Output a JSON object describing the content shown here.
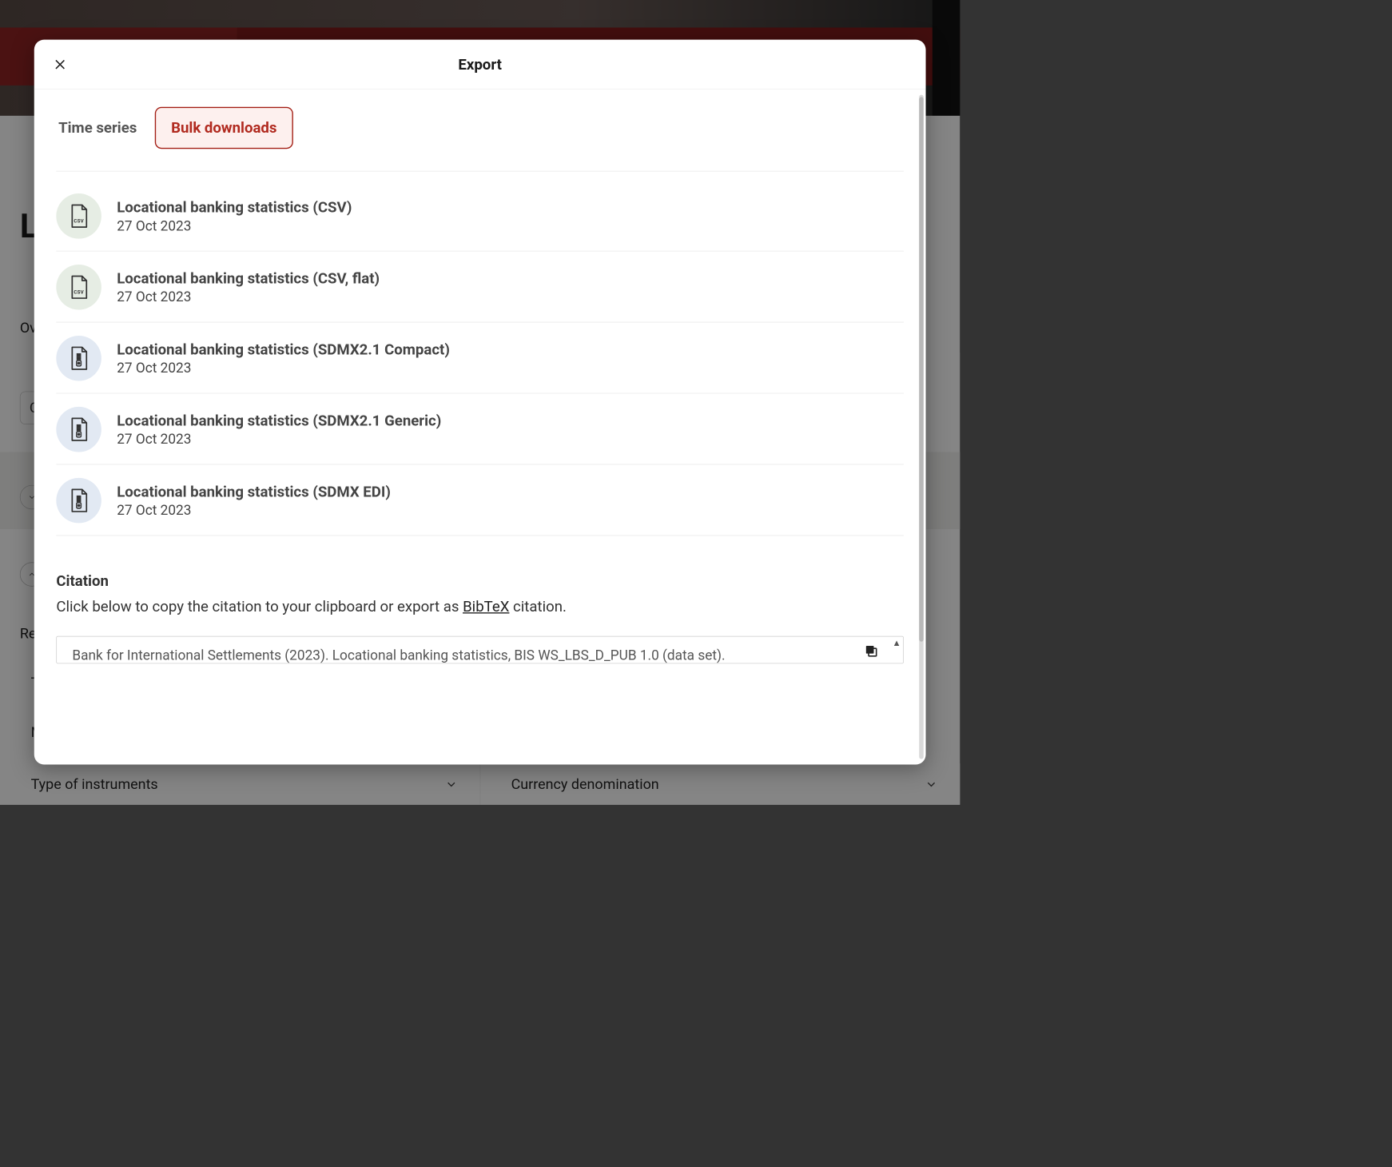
{
  "modal": {
    "title": "Export",
    "tabs": {
      "time_series": "Time series",
      "bulk_downloads": "Bulk downloads"
    },
    "downloads": [
      {
        "title": "Locational banking statistics (CSV)",
        "date": "27 Oct 2023",
        "icon": "csv"
      },
      {
        "title": "Locational banking statistics (CSV, flat)",
        "date": "27 Oct 2023",
        "icon": "csv"
      },
      {
        "title": "Locational banking statistics (SDMX2.1 Compact)",
        "date": "27 Oct 2023",
        "icon": "zip"
      },
      {
        "title": "Locational banking statistics (SDMX2.1 Generic)",
        "date": "27 Oct 2023",
        "icon": "zip"
      },
      {
        "title": "Locational banking statistics (SDMX EDI)",
        "date": "27 Oct 2023",
        "icon": "zip"
      }
    ],
    "citation": {
      "heading": "Citation",
      "instruction_pre": "Click below to copy the citation to your clipboard or export as ",
      "bibtex_label": "BibTeX",
      "instruction_post": " citation.",
      "text": "Bank for International Settlements (2023). Locational banking statistics, BIS WS_LBS_D_PUB 1.0 (data set)."
    }
  },
  "background": {
    "heading_fragment": "L",
    "ov": "Ov",
    "chip": "C",
    "re": "Re",
    "table_marker": "T",
    "m_marker": "M",
    "filters": {
      "type_of_instruments": "Type of instruments",
      "currency_denomination": "Currency denomination"
    }
  },
  "icons": {
    "csv": "csv-file-icon",
    "zip": "zip-file-icon"
  }
}
